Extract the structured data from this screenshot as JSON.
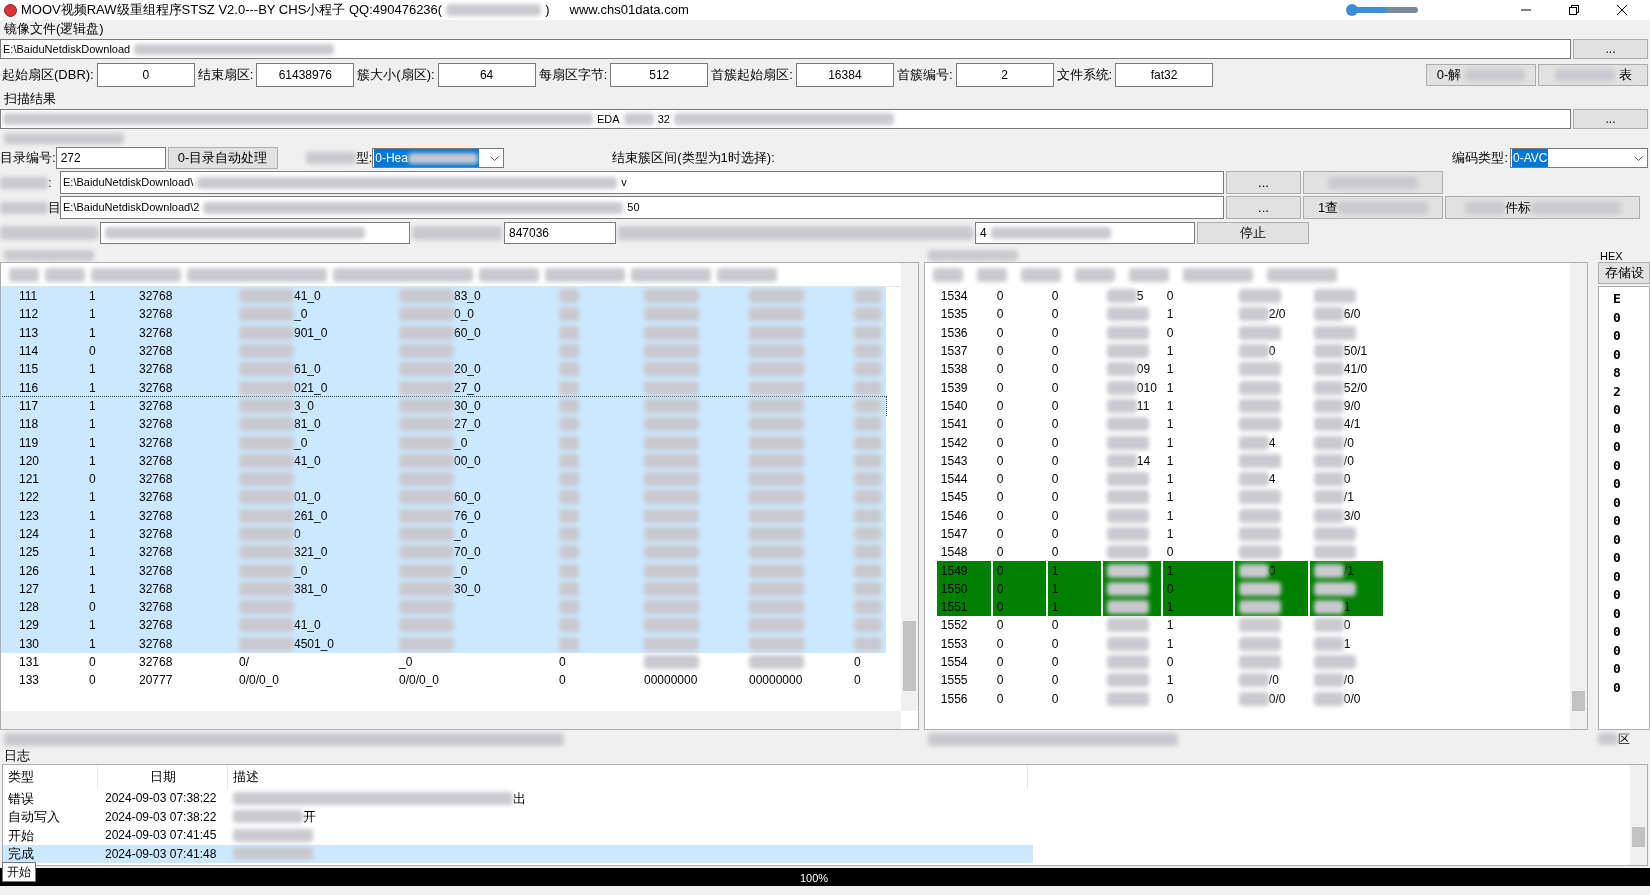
{
  "window": {
    "title": "MOOV视频RAW级重组程序STSZ V2.0---BY CHS小程子  QQ:490476236(",
    "title_tail": ")",
    "website": "www.chs01data.com",
    "slider": {
      "level": 0.55
    }
  },
  "image_file": {
    "label": "镜像文件(逻辑盘)",
    "path": "E:\\BaiduNetdiskDownload",
    "browse": "..."
  },
  "params": [
    {
      "label": "起始扇区(DBR):",
      "value": "0"
    },
    {
      "label": "结束扇区:",
      "value": "61438976"
    },
    {
      "label": "簇大小(扇区):",
      "value": "64"
    },
    {
      "label": "每扇区字节:",
      "value": "512"
    },
    {
      "label": "首簇起始扇区:",
      "value": "16384"
    },
    {
      "label": "首簇编号:",
      "value": "2"
    },
    {
      "label": "文件系统:",
      "value": "fat32"
    }
  ],
  "param_buttons": [
    {
      "text": "0-解",
      "redacted_before": false,
      "redacted_after": true
    },
    {
      "text": "表",
      "redacted_before": true,
      "redacted_after": false
    }
  ],
  "scan": {
    "label": "扫描结果",
    "fragments": [
      "EDA",
      "32"
    ],
    "browse": "..."
  },
  "dir": {
    "label": "目录编号:",
    "value": "272",
    "button": "0-目录自动处理",
    "type_label": "型:",
    "type_value": "0-Hea",
    "range_label": "结束簇区间(类型为1时选择):",
    "codec_label": "编码类型:",
    "codec_value": "0-AVC"
  },
  "path_rows": [
    {
      "label": ":",
      "path": "E:\\BaiduNetdiskDownload\\",
      "tail": "v",
      "browse": "...",
      "button": ""
    },
    {
      "label": "目",
      "path": "E:\\BaiduNetdiskDownload\\2",
      "tail": "50",
      "browse": "...",
      "button": "1查",
      "button2": "件标"
    }
  ],
  "progress_row": {
    "value1": "847036",
    "value2": "4",
    "stop": "停止"
  },
  "left_table": {
    "rows": [
      {
        "cells": [
          "111",
          "1",
          "32768",
          "41_0",
          "83_0"
        ],
        "selected": true,
        "focused": false
      },
      {
        "cells": [
          "112",
          "1",
          "32768",
          "_0",
          "0_0"
        ],
        "selected": true,
        "focused": false
      },
      {
        "cells": [
          "113",
          "1",
          "32768",
          "901_0",
          "60_0"
        ],
        "selected": true,
        "focused": false
      },
      {
        "cells": [
          "114",
          "0",
          "32768",
          "",
          ""
        ],
        "selected": true,
        "focused": false
      },
      {
        "cells": [
          "115",
          "1",
          "32768",
          "61_0",
          "20_0"
        ],
        "selected": true,
        "focused": false
      },
      {
        "cells": [
          "116",
          "1",
          "32768",
          "021_0",
          "27_0"
        ],
        "selected": true,
        "focused": false
      },
      {
        "cells": [
          "117",
          "1",
          "32768",
          "3_0",
          "30_0"
        ],
        "selected": true,
        "focused": true
      },
      {
        "cells": [
          "118",
          "1",
          "32768",
          "81_0",
          "27_0"
        ],
        "selected": true,
        "focused": false
      },
      {
        "cells": [
          "119",
          "1",
          "32768",
          "_0",
          "_0"
        ],
        "selected": true,
        "focused": false
      },
      {
        "cells": [
          "120",
          "1",
          "32768",
          "41_0",
          "00_0"
        ],
        "selected": true,
        "focused": false
      },
      {
        "cells": [
          "121",
          "0",
          "32768",
          "",
          ""
        ],
        "selected": true,
        "focused": false
      },
      {
        "cells": [
          "122",
          "1",
          "32768",
          "01_0",
          "60_0"
        ],
        "selected": true,
        "focused": false
      },
      {
        "cells": [
          "123",
          "1",
          "32768",
          "261_0",
          "76_0"
        ],
        "selected": true,
        "focused": false
      },
      {
        "cells": [
          "124",
          "1",
          "32768",
          "0",
          "_0"
        ],
        "selected": true,
        "focused": false
      },
      {
        "cells": [
          "125",
          "1",
          "32768",
          "321_0",
          "70_0"
        ],
        "selected": true,
        "focused": false
      },
      {
        "cells": [
          "126",
          "1",
          "32768",
          "_0",
          "_0"
        ],
        "selected": true,
        "focused": false
      },
      {
        "cells": [
          "127",
          "1",
          "32768",
          "381_0",
          "30_0"
        ],
        "selected": true,
        "focused": false
      },
      {
        "cells": [
          "128",
          "0",
          "32768",
          "",
          ""
        ],
        "selected": true,
        "focused": false
      },
      {
        "cells": [
          "129",
          "1",
          "32768",
          "41_0",
          ""
        ],
        "selected": true,
        "focused": false
      },
      {
        "cells": [
          "130",
          "1",
          "32768",
          "4501_0",
          ""
        ],
        "selected": true,
        "focused": false
      },
      {
        "cells": [
          "131",
          "0",
          "32768",
          "0/",
          "_0",
          "0",
          "",
          "",
          "0"
        ],
        "selected": false,
        "focused": false
      },
      {
        "cells": [
          "133",
          "0",
          "20777",
          "0/0/0_0",
          "0/0/0_0",
          "0",
          "00000000",
          "00000000",
          "0"
        ],
        "selected": false,
        "focused": false
      }
    ]
  },
  "right_table": {
    "rows": [
      {
        "cells": [
          "1534",
          "0",
          "0",
          "5",
          "0",
          "",
          ""
        ],
        "highlighted": false
      },
      {
        "cells": [
          "1535",
          "0",
          "0",
          "",
          "1",
          "2/0",
          "6/0"
        ],
        "highlighted": false
      },
      {
        "cells": [
          "1536",
          "0",
          "0",
          "",
          "0",
          "",
          ""
        ],
        "highlighted": false
      },
      {
        "cells": [
          "1537",
          "0",
          "0",
          "",
          "1",
          "0",
          "50/1"
        ],
        "highlighted": false
      },
      {
        "cells": [
          "1538",
          "0",
          "0",
          "09",
          "1",
          "",
          "41/0"
        ],
        "highlighted": false
      },
      {
        "cells": [
          "1539",
          "0",
          "0",
          "010",
          "1",
          "",
          "52/0"
        ],
        "highlighted": false
      },
      {
        "cells": [
          "1540",
          "0",
          "0",
          "11",
          "1",
          "",
          "9/0"
        ],
        "highlighted": false
      },
      {
        "cells": [
          "1541",
          "0",
          "0",
          "",
          "1",
          "",
          "4/1"
        ],
        "highlighted": false
      },
      {
        "cells": [
          "1542",
          "0",
          "0",
          "",
          "1",
          "4",
          "/0"
        ],
        "highlighted": false
      },
      {
        "cells": [
          "1543",
          "0",
          "0",
          "14",
          "1",
          "",
          "/0"
        ],
        "highlighted": false
      },
      {
        "cells": [
          "1544",
          "0",
          "0",
          "",
          "1",
          "4",
          "0"
        ],
        "highlighted": false
      },
      {
        "cells": [
          "1545",
          "0",
          "0",
          "",
          "1",
          "",
          "/1"
        ],
        "highlighted": false
      },
      {
        "cells": [
          "1546",
          "0",
          "0",
          "",
          "1",
          "",
          "3/0"
        ],
        "highlighted": false
      },
      {
        "cells": [
          "1547",
          "0",
          "0",
          "",
          "1",
          "",
          ""
        ],
        "highlighted": false
      },
      {
        "cells": [
          "1548",
          "0",
          "0",
          "",
          "0",
          "",
          ""
        ],
        "highlighted": false
      },
      {
        "cells": [
          "1549",
          "0",
          "1",
          "",
          "1",
          "0",
          "/1"
        ],
        "highlighted": true
      },
      {
        "cells": [
          "1550",
          "0",
          "1",
          "",
          "0",
          "",
          ""
        ],
        "highlighted": true
      },
      {
        "cells": [
          "1551",
          "0",
          "1",
          "",
          "1",
          "",
          "1"
        ],
        "highlighted": true
      },
      {
        "cells": [
          "1552",
          "0",
          "0",
          "",
          "1",
          "",
          "0"
        ],
        "highlighted": false
      },
      {
        "cells": [
          "1553",
          "0",
          "0",
          "",
          "1",
          "",
          "1"
        ],
        "highlighted": false
      },
      {
        "cells": [
          "1554",
          "0",
          "0",
          "",
          "0",
          "",
          ""
        ],
        "highlighted": false
      },
      {
        "cells": [
          "1555",
          "0",
          "0",
          "",
          "1",
          "/0",
          "/0"
        ],
        "highlighted": false
      },
      {
        "cells": [
          "1556",
          "0",
          "0",
          "",
          "0",
          "0/0",
          "0/0"
        ],
        "highlighted": false
      }
    ]
  },
  "hex": {
    "label": "HEX",
    "button": "存储设",
    "bytes": [
      "E",
      "0",
      "0",
      "0",
      "8",
      "2",
      "0",
      "0",
      "0",
      "0",
      "0",
      "0",
      "0",
      "0",
      "0",
      "0",
      "0",
      "0",
      "0",
      "0",
      "0",
      "0"
    ],
    "bottom_label": "区"
  },
  "log": {
    "label": "日志",
    "columns": [
      "类型",
      "日期",
      "描述"
    ],
    "rows": [
      {
        "type": "错误",
        "date": "2024-09-03 07:38:22",
        "desc": "出",
        "selected": false
      },
      {
        "type": "自动写入",
        "date": "2024-09-03 07:38:22",
        "desc": "开",
        "selected": false
      },
      {
        "type": "开始",
        "date": "2024-09-03 07:41:45",
        "desc": "",
        "selected": false
      },
      {
        "type": "完成",
        "date": "2024-09-03 07:41:48",
        "desc": "",
        "selected": true
      }
    ]
  },
  "status_bar": {
    "start": "开始",
    "progress": {
      "level": 1.0,
      "text": "100%"
    }
  }
}
